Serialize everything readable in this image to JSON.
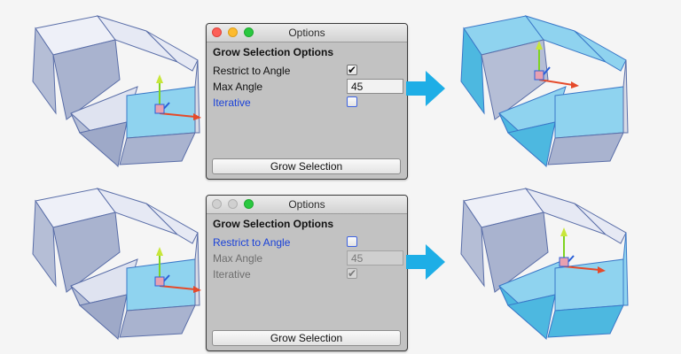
{
  "panels": [
    {
      "title": "Options",
      "heading": "Grow Selection Options",
      "restrict_label": "Restrict to Angle",
      "restrict_checked": "✔",
      "max_angle_label": "Max Angle",
      "max_angle_value": "45",
      "iterative_label": "Iterative",
      "iterative_checked": "",
      "button_label": "Grow Selection"
    },
    {
      "title": "Options",
      "heading": "Grow Selection Options",
      "restrict_label": "Restrict to Angle",
      "restrict_checked": "",
      "max_angle_label": "Max Angle",
      "max_angle_value": "45",
      "iterative_label": "Iterative",
      "iterative_checked": "✔",
      "button_label": "Grow Selection"
    }
  ],
  "colors": {
    "selection_blue": "#8fd3ef",
    "selection_blue_dark": "#4db8e0",
    "arrow_cyan": "#1eaee6",
    "focus_blue": "#1b42d8"
  }
}
